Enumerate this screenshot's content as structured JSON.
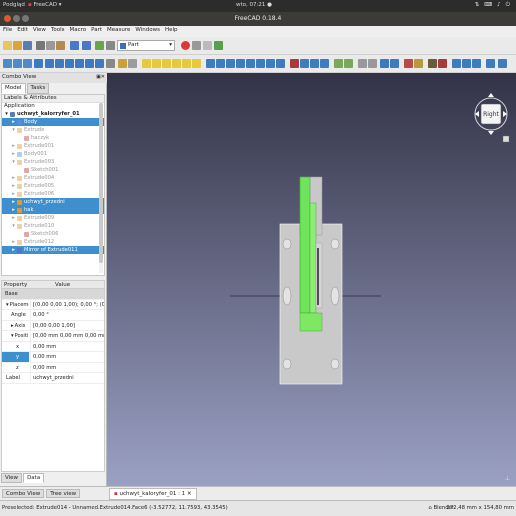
{
  "os_bar": {
    "left_app": "Podgląd",
    "app": "FreeCAD",
    "clock": "wto, 07:21 ●",
    "icons": [
      "network-icon",
      "keyboard-icon",
      "sound-icon",
      "power-icon"
    ]
  },
  "window": {
    "title": "FreeCAD 0.18.4"
  },
  "menu": [
    "File",
    "Edit",
    "View",
    "Tools",
    "Macro",
    "Part",
    "Measure",
    "Windows",
    "Help"
  ],
  "workbench": {
    "selected": "Part"
  },
  "combo": {
    "title": "Combo View",
    "tabs": [
      "Model",
      "Tasks"
    ],
    "tree_header": "Labels & Attributes",
    "application_label": "Application",
    "tree": [
      {
        "label": "uchwyt_kalorryfer_01",
        "level": 0,
        "arrow": "▾",
        "icon": "document-icon",
        "state": "bold"
      },
      {
        "label": "Body",
        "level": 1,
        "arrow": "▸",
        "icon": "body-icon",
        "state": "sel"
      },
      {
        "label": "Extrude",
        "level": 1,
        "arrow": "▾",
        "icon": "extrude-icon",
        "state": "dim"
      },
      {
        "label": "haczyk",
        "level": 2,
        "arrow": "",
        "icon": "sketch-icon",
        "state": "dim"
      },
      {
        "label": "Extrude001",
        "level": 1,
        "arrow": "▸",
        "icon": "extrude-icon",
        "state": "dim"
      },
      {
        "label": "Body001",
        "level": 1,
        "arrow": "▸",
        "icon": "body-icon",
        "state": "dim"
      },
      {
        "label": "Extrude003",
        "level": 1,
        "arrow": "▾",
        "icon": "extrude-icon",
        "state": "dim"
      },
      {
        "label": "Sketch001",
        "level": 2,
        "arrow": "",
        "icon": "sketch-icon",
        "state": "dim"
      },
      {
        "label": "Extrude004",
        "level": 1,
        "arrow": "▸",
        "icon": "extrude-icon",
        "state": "dim"
      },
      {
        "label": "Extrude005",
        "level": 1,
        "arrow": "▸",
        "icon": "extrude-icon",
        "state": "dim"
      },
      {
        "label": "Extrude006",
        "level": 1,
        "arrow": "▸",
        "icon": "extrude-icon",
        "state": "dim"
      },
      {
        "label": "uchwyt_przedni",
        "level": 1,
        "arrow": "▸",
        "icon": "extrude-icon",
        "state": "sel"
      },
      {
        "label": "hak",
        "level": 1,
        "arrow": "▸",
        "icon": "extrude-icon",
        "state": "sel"
      },
      {
        "label": "Extrude009",
        "level": 1,
        "arrow": "▸",
        "icon": "extrude-icon",
        "state": "dim"
      },
      {
        "label": "Extrude010",
        "level": 1,
        "arrow": "▾",
        "icon": "extrude-icon",
        "state": "dim"
      },
      {
        "label": "Sketch006",
        "level": 2,
        "arrow": "",
        "icon": "sketch-icon",
        "state": "dim"
      },
      {
        "label": "Extrude012",
        "level": 1,
        "arrow": "▸",
        "icon": "extrude-icon",
        "state": "dim"
      },
      {
        "label": "Mirror of Extrude011",
        "level": 1,
        "arrow": "▸",
        "icon": "mirror-icon",
        "state": "sel"
      }
    ],
    "property_columns": [
      "Property",
      "Value"
    ],
    "properties": [
      {
        "type": "group",
        "name": "Base"
      },
      {
        "name": "Placement",
        "value": "[(0,00 0,00 1,00); 0,00 °; (0,00 mm  0,00 ...",
        "arrow": "▾"
      },
      {
        "name": "Angle",
        "value": "0,00 °",
        "indent": 1
      },
      {
        "name": "Axis",
        "value": "[0,00 0,00 1,00]",
        "indent": 1,
        "arrow": "▸"
      },
      {
        "name": "Positi...",
        "value": "[0,00 mm  0,00 mm  0,00 mm]",
        "indent": 1,
        "arrow": "▾"
      },
      {
        "name": "x",
        "value": "0,00 mm",
        "indent": 2
      },
      {
        "name": "y",
        "value": "0,00 mm",
        "indent": 2,
        "selected": true
      },
      {
        "name": "z",
        "value": "0,00 mm",
        "indent": 2
      },
      {
        "name": "Label",
        "value": "uchwyt_przedni"
      }
    ],
    "view_tabs": [
      "View",
      "Data"
    ],
    "view_tab_active": "Data"
  },
  "bottom_tabs": [
    "Combo View",
    "Tree view"
  ],
  "document_tab": "uchwyt_kaloryfer_01 : 1",
  "document_tab_close": "✕",
  "nav_cube": {
    "face": "Right"
  },
  "status": {
    "message": "Preselected: Extrude014 - Unnamed.Extrude014.Face6 (-3.52772, 11.7593, 43.3545)",
    "navigation": "Blender",
    "dimensions": "272,48 mm x 154,80 mm"
  },
  "colors": {
    "selection": "#3d8fce",
    "model_gray": "#c8c8c8",
    "model_green": "#6fe35a",
    "viewport_top": "#333347",
    "viewport_bottom": "#9ba1c4"
  }
}
